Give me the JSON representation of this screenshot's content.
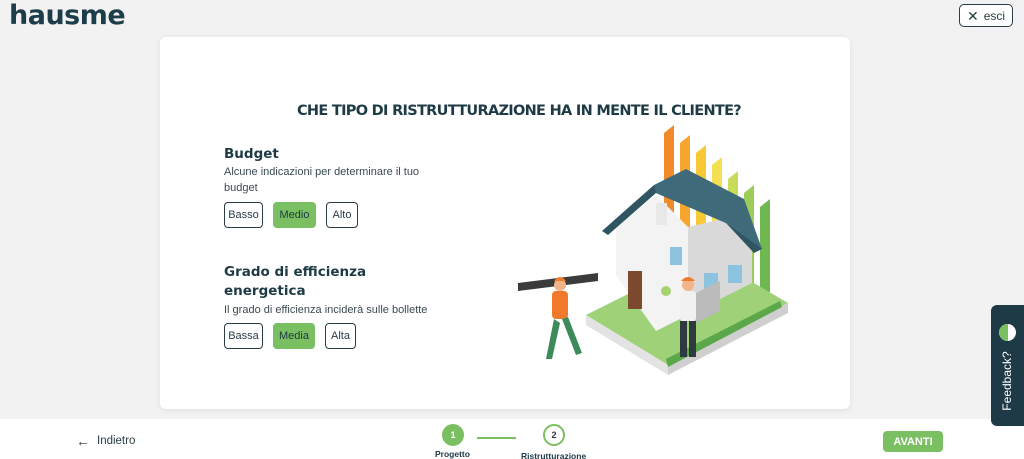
{
  "header": {
    "logo_text": "hausme",
    "esc_label": "esci"
  },
  "question": "CHE TIPO DI RISTRUTTURAZIONE HA IN MENTE IL CLIENTE?",
  "budget": {
    "title": "Budget",
    "description": "Alcune indicazioni per determinare il tuo budget",
    "options": [
      "Basso",
      "Medio",
      "Alto"
    ],
    "selected": "Medio"
  },
  "efficiency": {
    "title": "Grado di efficienza energetica",
    "description": "Il grado di efficienza inciderà sulle bollette",
    "options": [
      "Bassa",
      "Media",
      "Alta"
    ],
    "selected": "Media"
  },
  "footer": {
    "back_label": "Indietro",
    "steps": [
      {
        "number": "1",
        "label": "Progetto",
        "state": "completed"
      },
      {
        "number": "2",
        "label": "Ristrutturazione",
        "state": "current"
      }
    ],
    "next_label": "AVANTI"
  },
  "feedback": {
    "label": "Feedback?"
  },
  "colors": {
    "accent": "#7bbf63",
    "dark": "#1d3a45",
    "background": "#f2f2f2"
  },
  "icons": {
    "close": "close-icon",
    "back": "arrow-left-icon",
    "feedback": "feedback-icon"
  }
}
